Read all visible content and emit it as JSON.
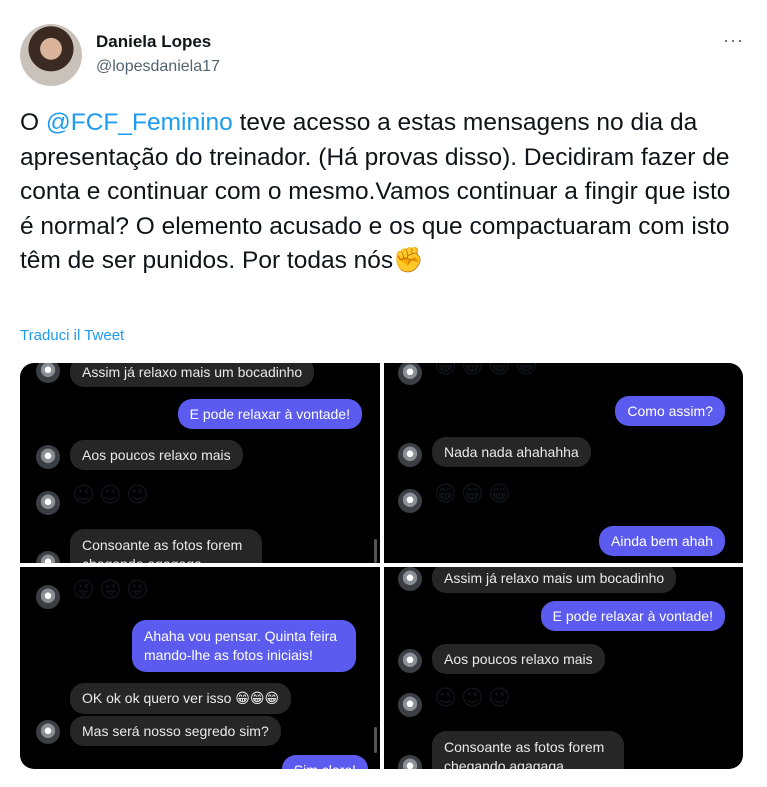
{
  "user": {
    "name": "Daniela Lopes",
    "handle": "@lopesdaniela17"
  },
  "more_label": "···",
  "tweet": {
    "text_prefix": "O ",
    "mention": "@FCF_Feminino",
    "text_body": " teve acesso a estas mensagens no dia da apresentação do treinador. (Há provas disso). Decidiram fazer de conta e continuar com o mesmo.Vamos continuar a fingir que isto é normal? O elemento acusado e os que compactuaram com isto têm de ser punidos. Por todas nós",
    "emoji": "✊",
    "translate": "Traduci il Tweet"
  },
  "panels": {
    "p1": {
      "m1": "Assim já relaxo mais um bocadinho",
      "m2": "E pode relaxar à vontade!",
      "m3": "Aos poucos relaxo mais",
      "m4": "😉😉😉",
      "m5": "Consoante as fotos forem chegando agagaga"
    },
    "p2": {
      "m1": "😁😁😁😁",
      "m2": "Como assim?",
      "m3": "Nada nada ahahahha",
      "m4": "😁😁😁",
      "m5": "Ainda bem ahah"
    },
    "p3": {
      "m1": "😜😜😜",
      "m2": "Ahaha vou pensar. Quinta feira mando-lhe as fotos iniciais!",
      "m3": "OK ok ok quero ver isso 😁😁😁",
      "m4": "Mas será nosso segredo sim?",
      "m5": "Sim claro!"
    },
    "p4": {
      "m1": "Assim já relaxo mais um bocadinho",
      "m2": "E pode relaxar à vontade!",
      "m3": "Aos poucos relaxo mais",
      "m4": "😉😉😉",
      "m5": "Consoante as fotos forem chegando agagaga"
    }
  }
}
